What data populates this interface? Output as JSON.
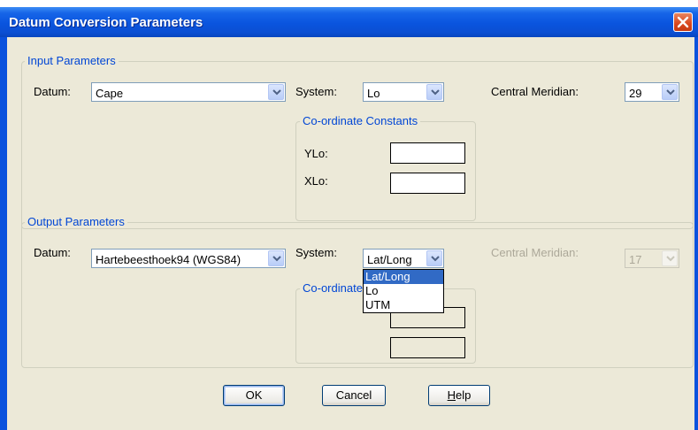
{
  "window": {
    "title": "Datum Conversion Parameters"
  },
  "input": {
    "legend": "Input Parameters",
    "datum_label": "Datum:",
    "datum_value": "Cape",
    "system_label": "System:",
    "system_value": "Lo",
    "cm_label": "Central Meridian:",
    "cm_value": "29",
    "constants": {
      "legend": "Co-ordinate Constants",
      "ylo_label": "YLo:",
      "xlo_label": "XLo:"
    }
  },
  "output": {
    "legend": "Output Parameters",
    "datum_label": "Datum:",
    "datum_value": "Hartebeesthoek94 (WGS84)",
    "system_label": "System:",
    "system_value": "Lat/Long",
    "cm_label": "Central Meridian:",
    "cm_value": "17",
    "constants_legend_partial": "Co-ordinate",
    "system_options": [
      "Lat/Long",
      "Lo",
      "UTM"
    ]
  },
  "buttons": {
    "ok": "OK",
    "cancel": "Cancel",
    "help": "Help",
    "help_mnemonic": "H",
    "help_rest": "elp"
  },
  "colors": {
    "title_bar": "#0a54de",
    "legend": "#0046d5",
    "selection": "#316ac5",
    "close": "#d9461d"
  }
}
